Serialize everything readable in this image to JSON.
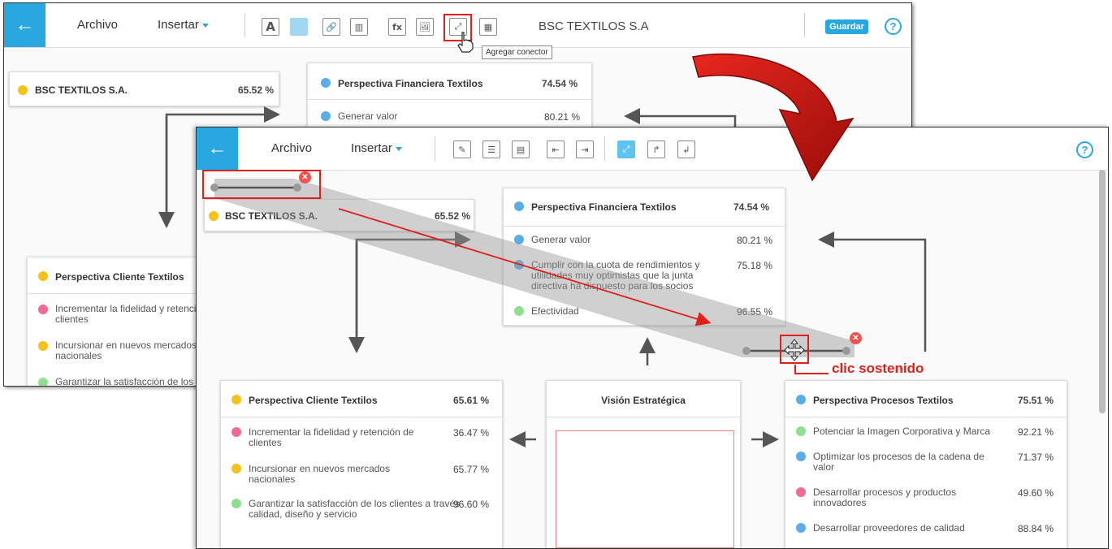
{
  "back_glyph": "←",
  "window1": {
    "menu": {
      "archivo": "Archivo",
      "insertar": "Insertar"
    },
    "tools": {
      "text": "A",
      "link": "🔗",
      "chart": "▥",
      "formula": "fx",
      "image": "🖼",
      "connector": "⤢",
      "grid": "▦"
    },
    "title": "BSC TEXTILOS S.A",
    "guardar": "Guardar",
    "help": "?",
    "tooltip": "Agregar conector",
    "bsc": {
      "name": "BSC TEXTILOS S.A.",
      "value": "65.52 %"
    },
    "financiera": {
      "title": "Perspectiva Financiera Textilos",
      "value": "74.54 %",
      "row1": "Generar valor",
      "row1_value": "80.21 %"
    },
    "cliente": {
      "title": "Perspectiva Cliente Textilos",
      "row1": "Incrementar la fidelidad y retenci",
      "row1b": "clientes",
      "row2": "Incursionar en nuevos mercados",
      "row2b": "nacionales",
      "row3": "Garantizar la satisfacción de los"
    }
  },
  "window2": {
    "menu": {
      "archivo": "Archivo",
      "insertar": "Insertar"
    },
    "tools": {
      "t1": "✎",
      "t2": "☰",
      "t3": "▤",
      "t4": "⇤",
      "t5": "⇥",
      "t6": "⤢",
      "t7": "↱",
      "t8": "↲"
    },
    "help": "?",
    "bsc": {
      "name": "BSC TEXTILOS S.A.",
      "value": "65.52 %"
    },
    "financiera": {
      "title": "Perspectiva Financiera Textilos",
      "value": "74.54 %",
      "rows": [
        {
          "text": "Generar valor",
          "value": "80.21 %",
          "color": "#5aaee8"
        },
        {
          "text": "Cumplir con la cuota de rendimientos y utilidades muy optimistas que la junta directiva ha dispuesto para los socios",
          "value": "75.18 %",
          "color": "#5aaee8"
        },
        {
          "text": "Efectividad",
          "value": "96.55 %",
          "color": "#8ee08e"
        }
      ]
    },
    "cliente": {
      "title": "Perspectiva Cliente Textilos",
      "value": "65.61 %",
      "rows": [
        {
          "text": "Incrementar la fidelidad y retención de clientes",
          "value": "36.47 %",
          "color": "#ef6a9a"
        },
        {
          "text": "Incursionar en nuevos mercados nacionales",
          "value": "65.77 %",
          "color": "#f5c21b"
        },
        {
          "text": "Garantizar la satisfacción de los clientes a través calidad, diseño y servicio",
          "value": "96.60 %",
          "color": "#8ee08e"
        }
      ]
    },
    "vision": {
      "title": "Visión Estratégica"
    },
    "procesos": {
      "title": "Perspectiva Procesos Textilos",
      "value": "75.51 %",
      "rows": [
        {
          "text": "Potenciar la Imagen Corporativa y Marca",
          "value": "92.21 %",
          "color": "#8ee08e"
        },
        {
          "text": "Optimizar los procesos de la cadena de valor",
          "value": "71.37 %",
          "color": "#5aaee8"
        },
        {
          "text": "Desarrollar procesos y productos innovadores",
          "value": "49.60 %",
          "color": "#ef6a9a"
        },
        {
          "text": "Desarrollar proveedores de calidad",
          "value": "88.84 %",
          "color": "#5aaee8"
        }
      ]
    }
  },
  "annotation": "clic sostenido",
  "colors": {
    "accent": "#29a8e0",
    "red": "#e0201b",
    "yellow": "#f5c21b",
    "blue": "#5aaee8",
    "pink": "#ef6a9a",
    "green": "#8ee08e"
  }
}
